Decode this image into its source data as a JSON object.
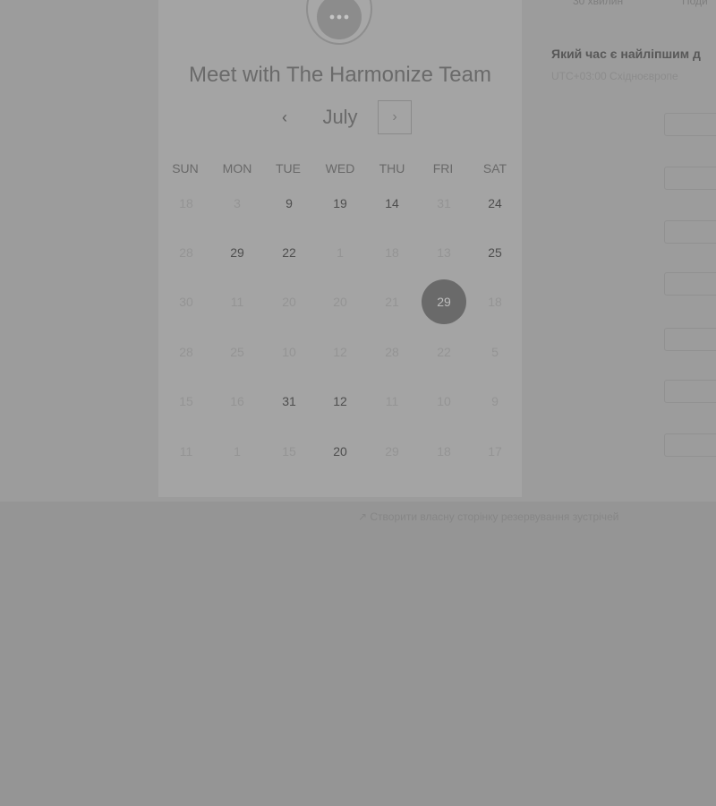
{
  "background": {
    "header_items": [
      "30 хвилин",
      "Поди"
    ],
    "question": "Який час є найліпшим д",
    "timezone": "UTC+03:00 Східноєвропе",
    "footer_link": "↗ Створити власну сторінку резервування зустрічей"
  },
  "modal": {
    "title": "Meet with The Harmonize Team",
    "month": "July",
    "prev_icon": "‹",
    "next_icon": "›",
    "weekdays": [
      "SUN",
      "MON",
      "TUE",
      "WED",
      "THU",
      "FRI",
      "SAT"
    ],
    "weeks": [
      [
        {
          "d": "18",
          "s": "u"
        },
        {
          "d": "3",
          "s": "u"
        },
        {
          "d": "9",
          "s": "a"
        },
        {
          "d": "19",
          "s": "a"
        },
        {
          "d": "14",
          "s": "a"
        },
        {
          "d": "31",
          "s": "u"
        },
        {
          "d": "24",
          "s": "a"
        }
      ],
      [
        {
          "d": "28",
          "s": "u"
        },
        {
          "d": "29",
          "s": "a"
        },
        {
          "d": "22",
          "s": "a"
        },
        {
          "d": "1",
          "s": "u"
        },
        {
          "d": "18",
          "s": "u"
        },
        {
          "d": "13",
          "s": "u"
        },
        {
          "d": "25",
          "s": "a"
        }
      ],
      [
        {
          "d": "30",
          "s": "u"
        },
        {
          "d": "11",
          "s": "u"
        },
        {
          "d": "20",
          "s": "u"
        },
        {
          "d": "20",
          "s": "u"
        },
        {
          "d": "21",
          "s": "u"
        },
        {
          "d": "29",
          "s": "s"
        },
        {
          "d": "18",
          "s": "u"
        }
      ],
      [
        {
          "d": "28",
          "s": "u"
        },
        {
          "d": "25",
          "s": "u"
        },
        {
          "d": "10",
          "s": "u"
        },
        {
          "d": "12",
          "s": "u"
        },
        {
          "d": "28",
          "s": "u"
        },
        {
          "d": "22",
          "s": "u"
        },
        {
          "d": "5",
          "s": "u"
        }
      ],
      [
        {
          "d": "15",
          "s": "u"
        },
        {
          "d": "16",
          "s": "u"
        },
        {
          "d": "31",
          "s": "a"
        },
        {
          "d": "12",
          "s": "a"
        },
        {
          "d": "11",
          "s": "u"
        },
        {
          "d": "10",
          "s": "u"
        },
        {
          "d": "9",
          "s": "u"
        }
      ],
      [
        {
          "d": "11",
          "s": "u"
        },
        {
          "d": "1",
          "s": "u"
        },
        {
          "d": "15",
          "s": "u"
        },
        {
          "d": "20",
          "s": "a"
        },
        {
          "d": "29",
          "s": "u"
        },
        {
          "d": "18",
          "s": "u"
        },
        {
          "d": "17",
          "s": "u"
        }
      ]
    ]
  },
  "colors": {
    "selected_day_bg": "#6a6a6a",
    "available_text": "#4e4e4e",
    "unavailable_text": "#949494"
  }
}
